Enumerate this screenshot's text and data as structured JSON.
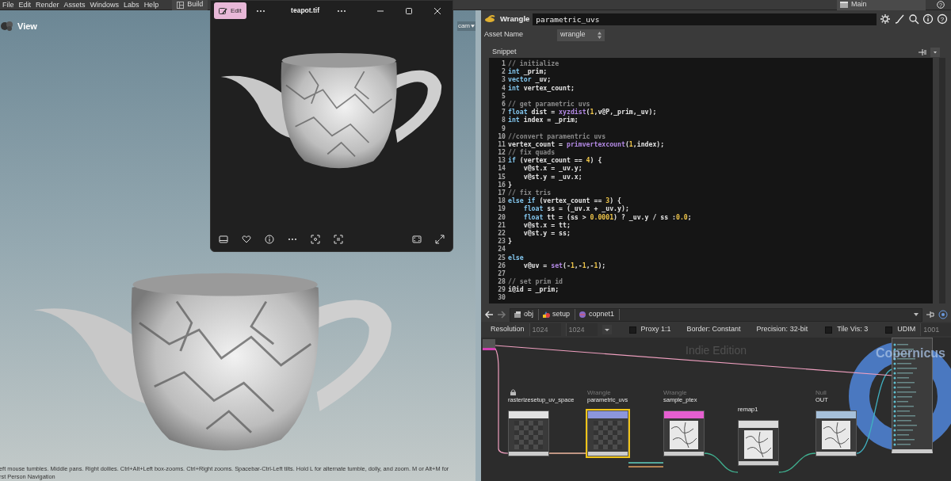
{
  "menu_bar": {
    "menus": [
      "File",
      "Edit",
      "Render",
      "Assets",
      "Windows",
      "Labs",
      "Help"
    ],
    "desk_tab": "Build",
    "desktop": "Main",
    "help": "?"
  },
  "viewport": {
    "title": "View",
    "camera": "cam",
    "status_lines": [
      "eft mouse tumbles. Middle pans. Right dollies. Ctrl+Alt+Left box-zooms. Ctrl+Right zooms. Spacebar-Ctrl-Left tilts. Hold L for alternate tumble, dolly, and zoom. M or Alt+M for",
      "rst Person Navigation"
    ]
  },
  "image_viewer": {
    "edit_button": "Edit",
    "title": "teapot.tif"
  },
  "parameters": {
    "node_type": "Wrangle",
    "node_name": "parametric_uvs",
    "help": "?",
    "asset_name_label": "Asset Name",
    "asset_name": "wrangle",
    "snippet_label": "Snippet",
    "code": [
      {
        "n": "1",
        "segs": [
          {
            "t": "// initialize",
            "kind": "comment"
          }
        ]
      },
      {
        "n": "2",
        "segs": [
          {
            "t": "int",
            "kind": "kw"
          },
          {
            "t": " _prim;",
            "kind": "plain"
          }
        ]
      },
      {
        "n": "3",
        "segs": [
          {
            "t": "vector",
            "kind": "kw"
          },
          {
            "t": " _uv;",
            "kind": "plain"
          }
        ]
      },
      {
        "n": "4",
        "segs": [
          {
            "t": "int",
            "kind": "kw"
          },
          {
            "t": " vertex_count;",
            "kind": "plain"
          }
        ]
      },
      {
        "n": "5"
      },
      {
        "n": "6",
        "segs": [
          {
            "t": "// get parametric uvs",
            "kind": "comment"
          }
        ]
      },
      {
        "n": "7",
        "segs": [
          {
            "t": "float",
            "kind": "kw"
          },
          {
            "t": " dist = ",
            "kind": "plain"
          },
          {
            "t": "xyzdist",
            "kind": "fn"
          },
          {
            "t": "(",
            "kind": "plain"
          },
          {
            "t": "1",
            "kind": "num"
          },
          {
            "t": ",v@P,_prim,_uv);",
            "kind": "plain"
          }
        ]
      },
      {
        "n": "8",
        "segs": [
          {
            "t": "int",
            "kind": "kw"
          },
          {
            "t": " index = _prim;",
            "kind": "plain"
          }
        ]
      },
      {
        "n": "9"
      },
      {
        "n": "10",
        "segs": [
          {
            "t": "//convert paramentric uvs",
            "kind": "comment"
          }
        ]
      },
      {
        "n": "11",
        "segs": [
          {
            "t": "vertex_count = ",
            "kind": "plain"
          },
          {
            "t": "primvertexcount",
            "kind": "fn"
          },
          {
            "t": "(",
            "kind": "plain"
          },
          {
            "t": "1",
            "kind": "num"
          },
          {
            "t": ",index);",
            "kind": "plain"
          }
        ]
      },
      {
        "n": "12",
        "segs": [
          {
            "t": "// fix quads",
            "kind": "comment"
          }
        ]
      },
      {
        "n": "13",
        "segs": [
          {
            "t": "if",
            "kind": "kw"
          },
          {
            "t": " (vertex_count == ",
            "kind": "plain"
          },
          {
            "t": "4",
            "kind": "num"
          },
          {
            "t": ") {",
            "kind": "plain"
          }
        ]
      },
      {
        "n": "14",
        "segs": [
          {
            "t": "    v@st.x = _uv.y;",
            "kind": "plain"
          }
        ]
      },
      {
        "n": "15",
        "segs": [
          {
            "t": "    v@st.y = _uv.x;",
            "kind": "plain"
          }
        ]
      },
      {
        "n": "16",
        "segs": [
          {
            "t": "}",
            "kind": "plain"
          }
        ]
      },
      {
        "n": "17",
        "segs": [
          {
            "t": "// fix tris",
            "kind": "comment"
          }
        ]
      },
      {
        "n": "18",
        "segs": [
          {
            "t": "else if",
            "kind": "kw"
          },
          {
            "t": " (vertex_count == ",
            "kind": "plain"
          },
          {
            "t": "3",
            "kind": "num"
          },
          {
            "t": ") {",
            "kind": "plain"
          }
        ]
      },
      {
        "n": "19",
        "segs": [
          {
            "t": "    float",
            "kind": "kw"
          },
          {
            "t": " ss = (_uv.x + _uv.y);",
            "kind": "plain"
          }
        ]
      },
      {
        "n": "20",
        "segs": [
          {
            "t": "    float",
            "kind": "kw"
          },
          {
            "t": " tt = (ss > ",
            "kind": "plain"
          },
          {
            "t": "0.0001",
            "kind": "num"
          },
          {
            "t": ") ? _uv.y / ss :",
            "kind": "plain"
          },
          {
            "t": "0.0",
            "kind": "num"
          },
          {
            "t": ";",
            "kind": "plain"
          }
        ]
      },
      {
        "n": "21",
        "segs": [
          {
            "t": "    v@st.x = tt;",
            "kind": "plain"
          }
        ]
      },
      {
        "n": "22",
        "segs": [
          {
            "t": "    v@st.y = ss;",
            "kind": "plain"
          }
        ]
      },
      {
        "n": "23",
        "segs": [
          {
            "t": "}",
            "kind": "plain"
          }
        ]
      },
      {
        "n": "24"
      },
      {
        "n": "25",
        "segs": [
          {
            "t": "else",
            "kind": "kw"
          }
        ]
      },
      {
        "n": "26",
        "segs": [
          {
            "t": "    v@uv = ",
            "kind": "plain"
          },
          {
            "t": "set",
            "kind": "fn"
          },
          {
            "t": "(-",
            "kind": "plain"
          },
          {
            "t": "1",
            "kind": "num"
          },
          {
            "t": ",-",
            "kind": "plain"
          },
          {
            "t": "1",
            "kind": "num"
          },
          {
            "t": ",-",
            "kind": "plain"
          },
          {
            "t": "1",
            "kind": "num"
          },
          {
            "t": ");",
            "kind": "plain"
          }
        ]
      },
      {
        "n": "27"
      },
      {
        "n": "28",
        "segs": [
          {
            "t": "// set prim id",
            "kind": "comment"
          }
        ]
      },
      {
        "n": "29",
        "segs": [
          {
            "t": "i@id = _prim;",
            "kind": "plain"
          }
        ]
      },
      {
        "n": "30"
      }
    ]
  },
  "network": {
    "path": [
      "obj",
      "setup",
      "copnet1"
    ],
    "toolbar": [
      {
        "kind": "label",
        "text": "Resolution"
      },
      {
        "kind": "field",
        "value": "1024"
      },
      {
        "kind": "field",
        "value": "1024"
      },
      {
        "kind": "menu"
      },
      {
        "kind": "checkbox",
        "checked": false,
        "text": "Proxy 1:1"
      },
      {
        "kind": "label",
        "text": "Border: Constant"
      },
      {
        "kind": "label",
        "text": "Precision: 32-bit"
      },
      {
        "kind": "checkbox",
        "checked": false,
        "text": "Tile Vis: 3"
      },
      {
        "kind": "checkbox",
        "checked": false,
        "text": "UDIM"
      },
      {
        "kind": "field",
        "value": "1001"
      }
    ],
    "watermark": "Indie Edition",
    "context_label": "Copernicus",
    "nodes": [
      {
        "name": "rasterizesetup_uv_space",
        "color": "#e2e2e2",
        "selected": false,
        "locked": true,
        "preview": {
          "kind": "checker"
        }
      },
      {
        "type_label": "Wrangle",
        "name": "parametric_uvs",
        "color": "#8c96dc",
        "selected": true,
        "locked": false,
        "preview": {
          "kind": "checker"
        }
      },
      {
        "type_label": "Wrangle",
        "name": "sample_ptex",
        "color": "#e55fd0",
        "selected": false,
        "locked": false,
        "preview": {
          "kind": "image"
        }
      },
      {
        "name": "remap1",
        "color": "#dcdcdc",
        "selected": false,
        "locked": false,
        "preview": {
          "kind": "image"
        }
      },
      {
        "type_label": "Null",
        "name": "OUT",
        "color": "#a6c0da",
        "selected": false,
        "locked": false,
        "preview": {
          "kind": "image"
        }
      }
    ]
  }
}
